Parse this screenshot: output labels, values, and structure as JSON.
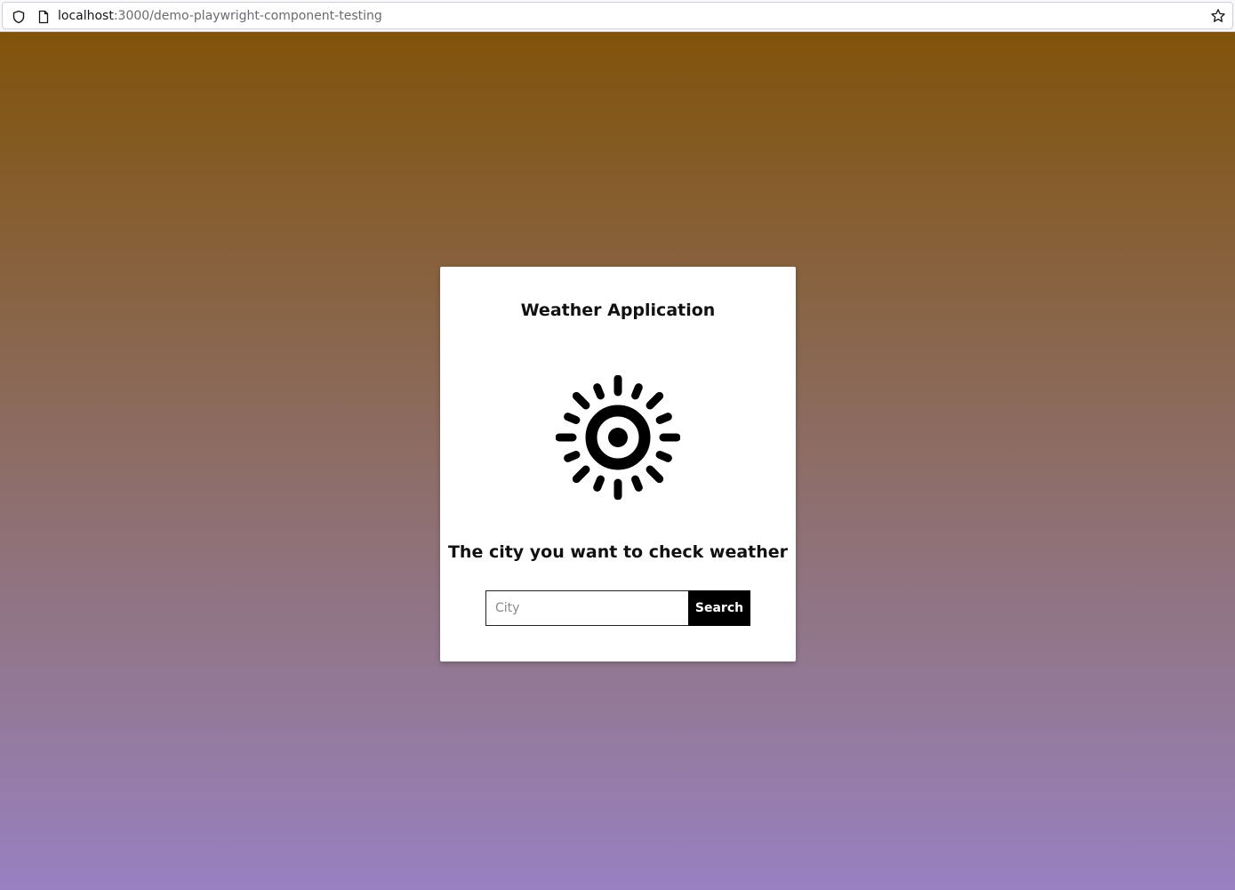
{
  "browser": {
    "url_host": "localhost",
    "url_path": ":3000/demo-playwright-component-testing"
  },
  "card": {
    "title": "Weather Application",
    "icon": "sun-icon",
    "prompt": "The city you want to check weather"
  },
  "search": {
    "placeholder": "City",
    "value": "",
    "button_label": "Search"
  },
  "colors": {
    "gradient_top": "#81530a",
    "gradient_bottom": "#9880c2",
    "button_bg": "#000000"
  }
}
